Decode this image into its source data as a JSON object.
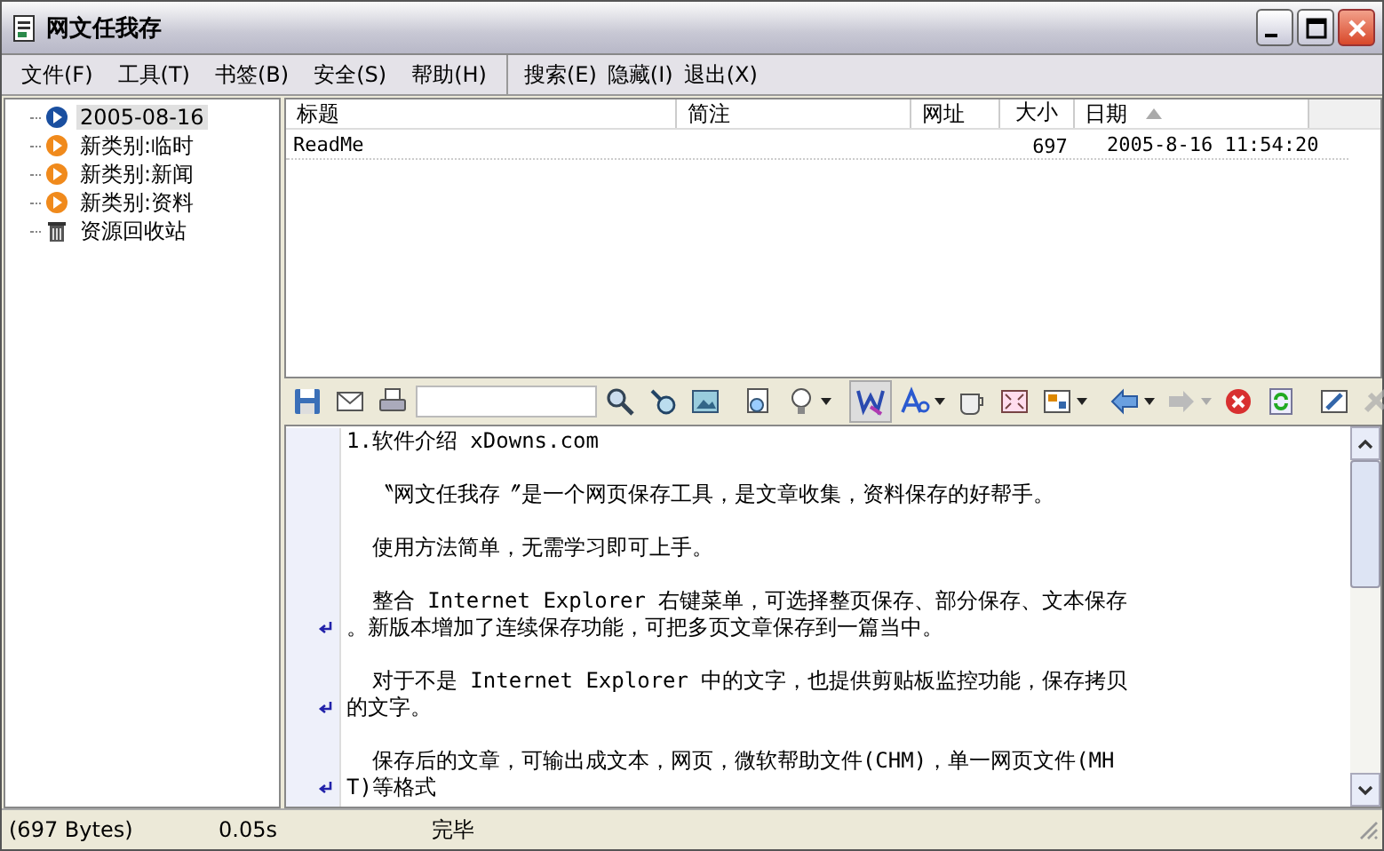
{
  "window": {
    "title": "网文任我存"
  },
  "menu": [
    {
      "label": "文件(F)",
      "kind": "menu"
    },
    {
      "label": "工具(T)",
      "kind": "menu"
    },
    {
      "label": "书签(B)",
      "kind": "menu"
    },
    {
      "label": "安全(S)",
      "kind": "menu"
    },
    {
      "label": "帮助(H)",
      "kind": "menu"
    },
    {
      "label": "搜索(E)",
      "kind": "command"
    },
    {
      "label": "隐藏(I)",
      "kind": "command"
    },
    {
      "label": "退出(X)",
      "kind": "command"
    }
  ],
  "tree": [
    {
      "label": "2005-08-16",
      "kind": "today",
      "selected": true
    },
    {
      "label": "新类别:临时",
      "kind": "category",
      "selected": false
    },
    {
      "label": "新类别:新闻",
      "kind": "category",
      "selected": false
    },
    {
      "label": "新类别:资料",
      "kind": "category",
      "selected": false
    },
    {
      "label": "资源回收站",
      "kind": "trash",
      "selected": false
    }
  ],
  "table": {
    "columns": [
      {
        "label": "标题",
        "sorted": false
      },
      {
        "label": "简注",
        "sorted": false
      },
      {
        "label": "网址",
        "sorted": false
      },
      {
        "label": "大小",
        "sorted": false
      },
      {
        "label": "日期",
        "sorted": true
      }
    ],
    "rows": [
      [
        "ReadMe",
        "",
        "",
        "697",
        "2005-8-16 11:54:20"
      ]
    ]
  },
  "editor": {
    "paragraphs": [
      {
        "lines": [
          {
            "text": "1.软件介绍 xDowns.com",
            "wrapped": false
          }
        ]
      },
      {
        "lines": [
          {
            "text": "  〝网文任我存〞是一个网页保存工具，是文章收集，资料保存的好帮手。",
            "wrapped": false
          }
        ]
      },
      {
        "lines": [
          {
            "text": "  使用方法简单，无需学习即可上手。",
            "wrapped": false
          }
        ]
      },
      {
        "lines": [
          {
            "text": "  整合 Internet Explorer 右键菜单，可选择整页保存、部分保存、文本保存",
            "wrapped": false
          },
          {
            "text": "。新版本增加了连续保存功能，可把多页文章保存到一篇当中。",
            "wrapped": true
          }
        ]
      },
      {
        "lines": [
          {
            "text": "  对于不是 Internet Explorer 中的文字，也提供剪贴板监控功能，保存拷贝",
            "wrapped": false
          },
          {
            "text": "的文字。",
            "wrapped": true
          }
        ]
      },
      {
        "lines": [
          {
            "text": "  保存后的文章，可输出成文本，网页，微软帮助文件(CHM)，单一网页文件(MH",
            "wrapped": false
          },
          {
            "text": "T)等格式",
            "wrapped": true
          }
        ]
      }
    ]
  },
  "status_bar": [
    "(697 Bytes)",
    "0.05s",
    "完毕"
  ]
}
